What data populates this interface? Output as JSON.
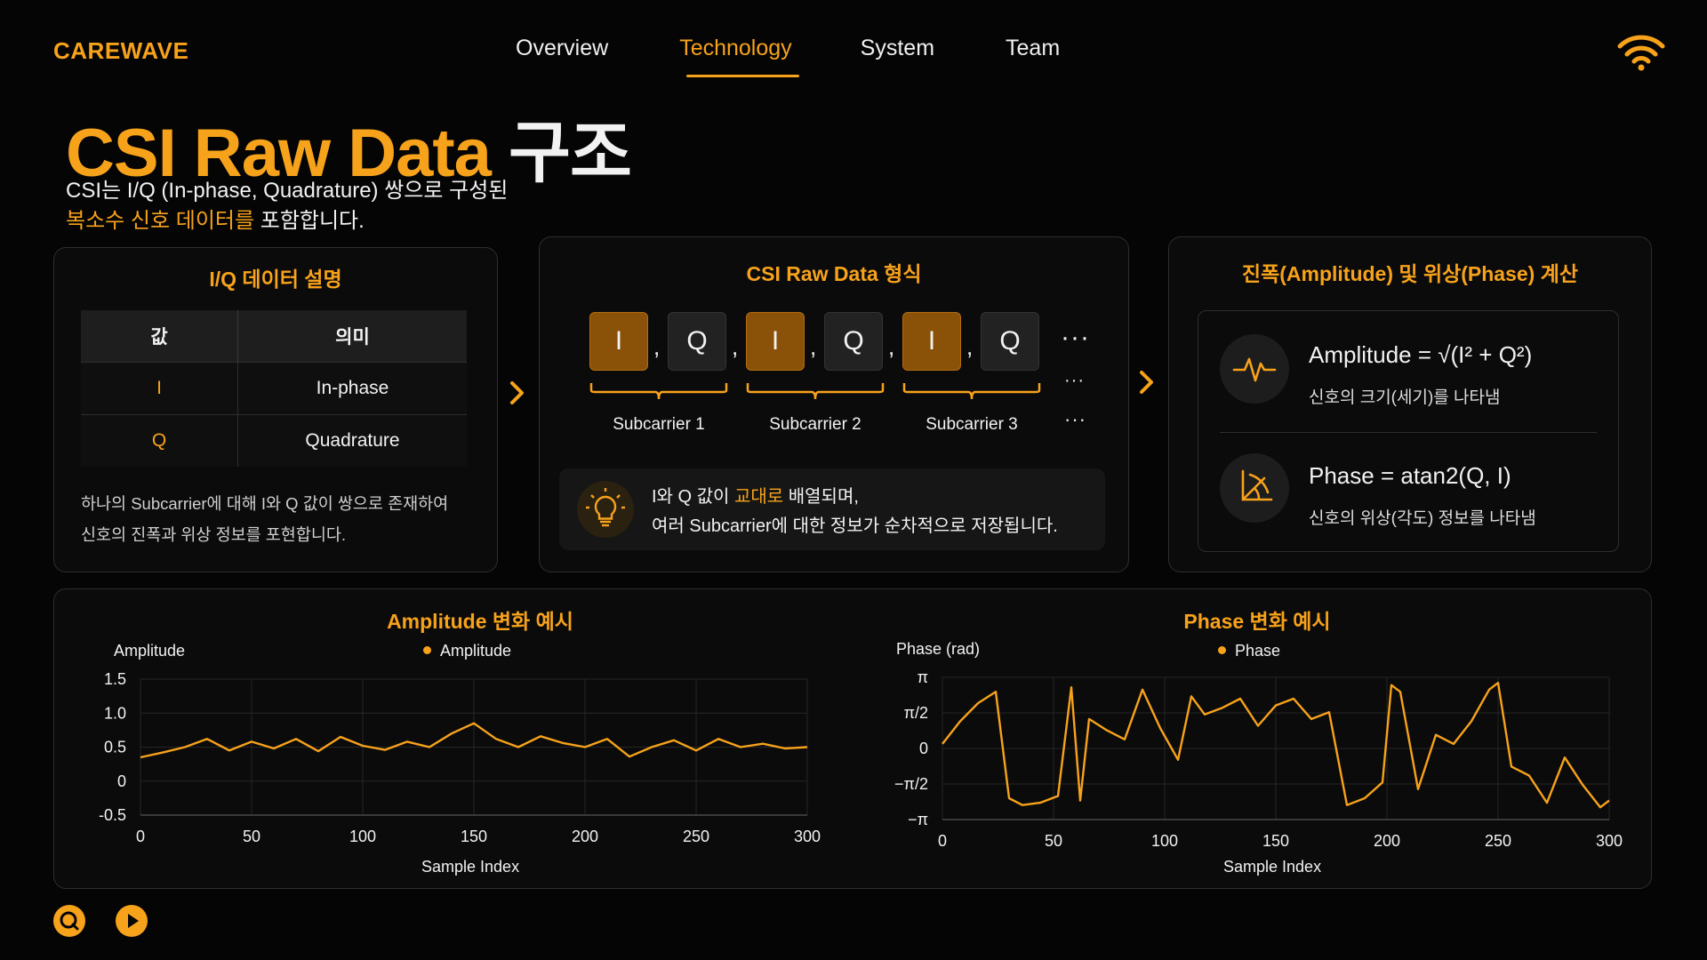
{
  "header": {
    "logo": "CAREWAVE",
    "nav": [
      "Overview",
      "Technology",
      "System",
      "Team"
    ],
    "active_nav": "Technology",
    "status_icon": "wifi-icon"
  },
  "hero": {
    "title_highlight": "CSI Raw Data",
    "title_rest": "구조",
    "subtitle_line1": "CSI는 I/Q (In-phase, Quadrature) 쌍으로 구성된",
    "subtitle_highlight": "복소수 신호 데이터를",
    "subtitle_end": "포함합니다."
  },
  "iq_panel": {
    "title": "I/Q 데이터 설명",
    "headers": [
      "값",
      "의미"
    ],
    "rows": [
      [
        "I",
        "In-phase"
      ],
      [
        "Q",
        "Quadrature"
      ]
    ],
    "desc_line1": "하나의 Subcarrier에 대해 I와 Q 값이 쌍으로 존재하여",
    "desc_line2": "신호의 진폭과 위상 정보를 포현합니다."
  },
  "raw_panel": {
    "title": "CSI Raw Data 형식",
    "cells": [
      "I",
      "Q",
      "I",
      "Q",
      "I",
      "Q"
    ],
    "separator": ",",
    "ellipsis": "···",
    "subcarriers": [
      "Subcarrier 1",
      "Subcarrier 2",
      "Subcarrier 3"
    ],
    "tip_part1": "I와 Q 값이 ",
    "tip_highlight": "교대로",
    "tip_part2": " 배열되며,",
    "tip_line2": "여러 Subcarrier에 대한 정보가 순차적으로 저장됩니다."
  },
  "calc_panel": {
    "title": "진폭(Amplitude) 및 위상(Phase) 계산",
    "amplitude_name": "Amplitude = √(I² + Q²)",
    "amplitude_desc": "신호의 크기(세기)를 나타냄",
    "phase_name": "Phase = atan2(Q, I)",
    "phase_desc": "신호의 위상(각도) 정보를 나타냄",
    "icons": [
      "pulse-icon",
      "angle-icon"
    ]
  },
  "colors": {
    "accent": "#f7a21b",
    "background": "#050505",
    "panel_border": "#2e2e2e"
  },
  "chart_data": [
    {
      "type": "line",
      "title": "Amplitude 변화 예시",
      "ylabel": "Amplitude",
      "xlabel": "Sample Index",
      "legend": [
        "Amplitude"
      ],
      "xlim": [
        0,
        300
      ],
      "ylim": [
        -0.5,
        1.5
      ],
      "x_ticks": [
        "0",
        "50",
        "100",
        "150",
        "200",
        "250",
        "300"
      ],
      "y_ticks": [
        "1.5",
        "1.0",
        "0.5",
        "0",
        "-0.5"
      ],
      "grid": true,
      "series": [
        {
          "name": "Amplitude",
          "x": [
            0,
            10,
            20,
            30,
            40,
            50,
            60,
            70,
            80,
            90,
            100,
            110,
            120,
            130,
            140,
            150,
            160,
            170,
            180,
            190,
            200,
            210,
            220,
            230,
            240,
            250,
            260,
            270,
            280,
            290,
            300
          ],
          "y": [
            0.35,
            0.42,
            0.5,
            0.62,
            0.45,
            0.58,
            0.48,
            0.62,
            0.44,
            0.65,
            0.52,
            0.46,
            0.58,
            0.5,
            0.7,
            0.85,
            0.62,
            0.5,
            0.66,
            0.56,
            0.5,
            0.62,
            0.36,
            0.5,
            0.6,
            0.45,
            0.62,
            0.5,
            0.55,
            0.48,
            0.5
          ]
        }
      ]
    },
    {
      "type": "line",
      "title": "Phase 변화 예시",
      "ylabel": "Phase (rad)",
      "xlabel": "Sample Index",
      "legend": [
        "Phase"
      ],
      "xlim": [
        0,
        300
      ],
      "ylim": [
        -3.1416,
        3.1416
      ],
      "x_ticks": [
        "0",
        "50",
        "100",
        "150",
        "200",
        "250",
        "300"
      ],
      "y_ticks": [
        "π",
        "π/2",
        "0",
        "−π/2",
        "−π"
      ],
      "grid": true,
      "series": [
        {
          "name": "Phase",
          "x": [
            0,
            8,
            16,
            24,
            30,
            36,
            44,
            52,
            58,
            62,
            66,
            74,
            82,
            90,
            98,
            106,
            112,
            118,
            126,
            134,
            142,
            150,
            158,
            166,
            174,
            182,
            190,
            198,
            202,
            206,
            214,
            222,
            230,
            238,
            246,
            250,
            256,
            264,
            272,
            280,
            288,
            296,
            300
          ],
          "y": [
            0.2,
            1.2,
            2.0,
            2.5,
            -2.2,
            -2.5,
            -2.4,
            -2.1,
            2.7,
            -2.3,
            1.3,
            0.8,
            0.4,
            2.6,
            0.9,
            -0.5,
            2.3,
            1.5,
            1.8,
            2.2,
            1.0,
            1.9,
            2.2,
            1.3,
            1.6,
            -2.5,
            -2.2,
            -1.5,
            2.8,
            2.5,
            -1.8,
            0.6,
            0.2,
            1.2,
            2.6,
            2.9,
            -0.8,
            -1.2,
            -2.4,
            -0.4,
            -1.6,
            -2.6,
            -2.3
          ]
        }
      ]
    }
  ],
  "bottom_controls": [
    "search-icon",
    "play-icon"
  ]
}
